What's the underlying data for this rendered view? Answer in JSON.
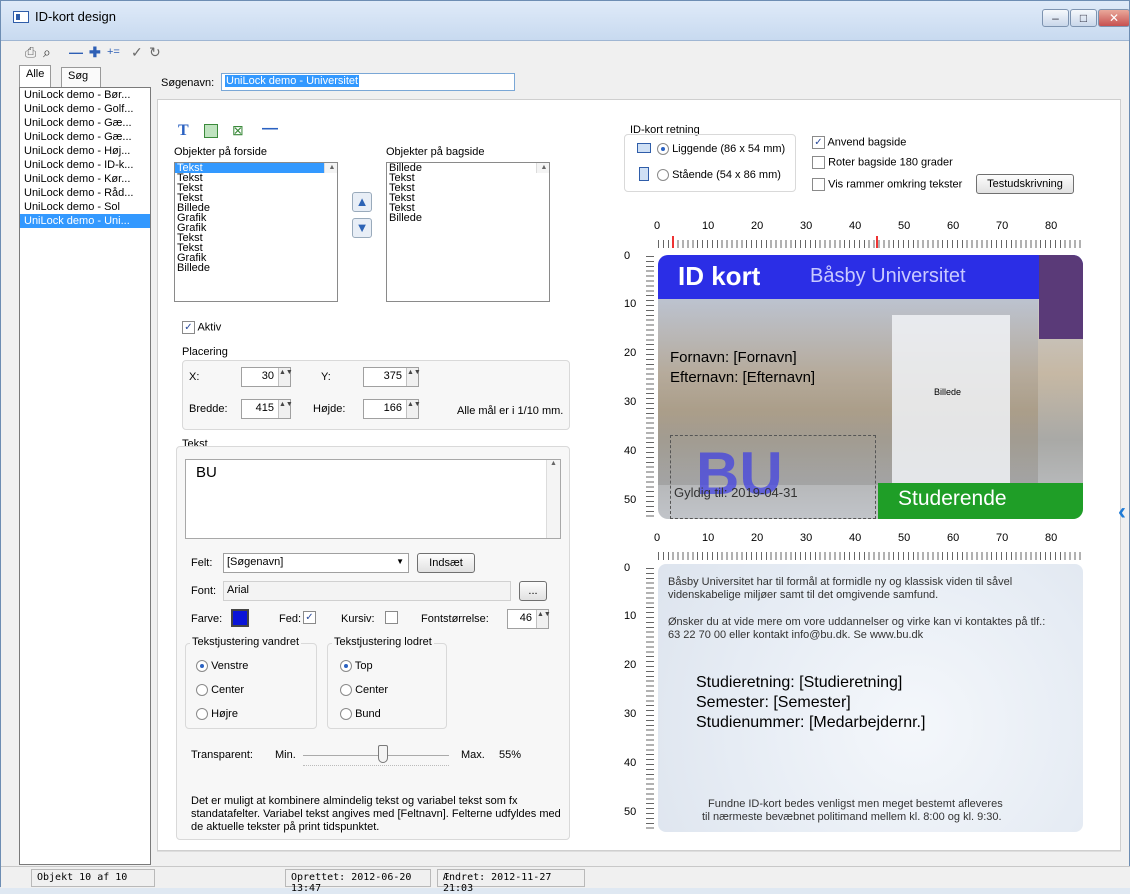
{
  "window": {
    "title": "ID-kort design",
    "min": "–",
    "max": "□",
    "close": "✕"
  },
  "toolbar": {
    "icons": [
      "printer-icon",
      "binoculars-icon",
      "remove-icon",
      "add-icon",
      "add-list-icon",
      "check-icon",
      "refresh-icon"
    ]
  },
  "left_panel": {
    "tabs": [
      "Alle",
      "Søg"
    ],
    "items": [
      "UniLock demo - Bør...",
      "UniLock demo - Golf...",
      "UniLock demo - Gæ...",
      "UniLock demo - Gæ...",
      "UniLock demo - Høj...",
      "UniLock demo - ID-k...",
      "UniLock demo - Kør...",
      "UniLock demo - Råd...",
      "UniLock demo - Sol",
      "UniLock demo - Uni..."
    ],
    "selected_index": 9
  },
  "search": {
    "label": "Søgenavn:",
    "value": "UniLock demo - Universitet"
  },
  "objects": {
    "front_label": "Objekter på forside",
    "front_items": [
      "Tekst",
      "Tekst",
      "Tekst",
      "Tekst",
      "Billede",
      "Grafik",
      "Grafik",
      "Tekst",
      "Tekst",
      "Grafik",
      "Billede"
    ],
    "back_label": "Objekter på bagside",
    "back_items": [
      "Billede",
      "Tekst",
      "Tekst",
      "Tekst",
      "Tekst",
      "Billede"
    ],
    "aktiv_label": "Aktiv",
    "up_arrow": "▲",
    "down_arrow": "▼"
  },
  "placering": {
    "title": "Placering",
    "x_label": "X:",
    "x_value": "30",
    "y_label": "Y:",
    "y_value": "375",
    "bredde_label": "Bredde:",
    "bredde_value": "415",
    "hojde_label": "Højde:",
    "hojde_value": "166",
    "unit_note": "Alle mål er i 1/10 mm."
  },
  "tekst": {
    "title": "Tekst",
    "content": "BU",
    "felt_label": "Felt:",
    "felt_value": "[Søgenavn]",
    "indsaet": "Indsæt",
    "font_label": "Font:",
    "font_value": "Arial",
    "font_btn": "...",
    "farve_label": "Farve:",
    "fed_label": "Fed:",
    "kursiv_label": "Kursiv:",
    "fontsize_label": "Fontstørrelse:",
    "fontsize_value": "46",
    "color": "#0a14d8",
    "h_align_title": "Tekstjustering vandret",
    "h_align": [
      "Venstre",
      "Center",
      "Højre"
    ],
    "v_align_title": "Tekstjustering lodret",
    "v_align": [
      "Top",
      "Center",
      "Bund"
    ],
    "transparent_label": "Transparent:",
    "min": "Min.",
    "max": "Max.",
    "transparency_value": "55%",
    "help": "Det er muligt at kombinere almindelig tekst og variabel tekst som fx standatafelter. Variabel tekst angives med [Feltnavn]. Felterne udfyldes med de aktuelle tekster på print tidspunktet."
  },
  "card_settings": {
    "orientation_title": "ID-kort retning",
    "landscape": "Liggende (86 x 54 mm)",
    "portrait": "Stående (54 x 86 mm)",
    "use_back": "Anvend bagside",
    "rotate_back": "Roter bagside 180 grader",
    "show_frames": "Vis rammer omkring tekster",
    "test_print": "Testudskrivning"
  },
  "ruler": {
    "x_ticks": [
      "0",
      "10",
      "20",
      "30",
      "40",
      "50",
      "60",
      "70",
      "80"
    ],
    "y_ticks_front": [
      "0",
      "10",
      "20",
      "30",
      "40",
      "50"
    ],
    "y_ticks_back": [
      "0",
      "10",
      "20",
      "30",
      "40",
      "50"
    ]
  },
  "card_front": {
    "title": "ID kort",
    "university": "Båsby Universitet",
    "name_line1": "Fornavn: [Fornavn]",
    "name_line2": "Efternavn: [Efternavn]",
    "photo_label": "Billede",
    "bu": "BU",
    "valid": "Gyldig til: 2019-04-31",
    "role": "Studerende",
    "header_color": "#2b2ee6",
    "role_color": "#1f9e27",
    "corner_color": "#5a3a78"
  },
  "card_back": {
    "para1": "Båsby Universitet har til formål at formidle ny og klassisk viden til såvel videnskabelige miljøer samt til det omgivende samfund.",
    "para2": "Ønsker du at vide mere om vore uddannelser og virke kan vi kontaktes på tlf.: 63 22 70 00 eller kontakt info@bu.dk. Se www.bu.dk",
    "field1": "Studieretning: [Studieretning]",
    "field2": "Semester: [Semester]",
    "field3": "Studienummer: [Medarbejdernr.]",
    "footer1": "Fundne ID-kort bedes venligst men meget bestemt afleveres",
    "footer2": "til nærmeste bevæbnet politimand mellem kl. 8:00 og kl. 9:30."
  },
  "collapse_arrow": "‹",
  "status": {
    "count": "Objekt 10 af 10",
    "created": "Oprettet: 2012-06-20 13:47",
    "modified": "Ændret: 2012-11-27 21:03"
  }
}
